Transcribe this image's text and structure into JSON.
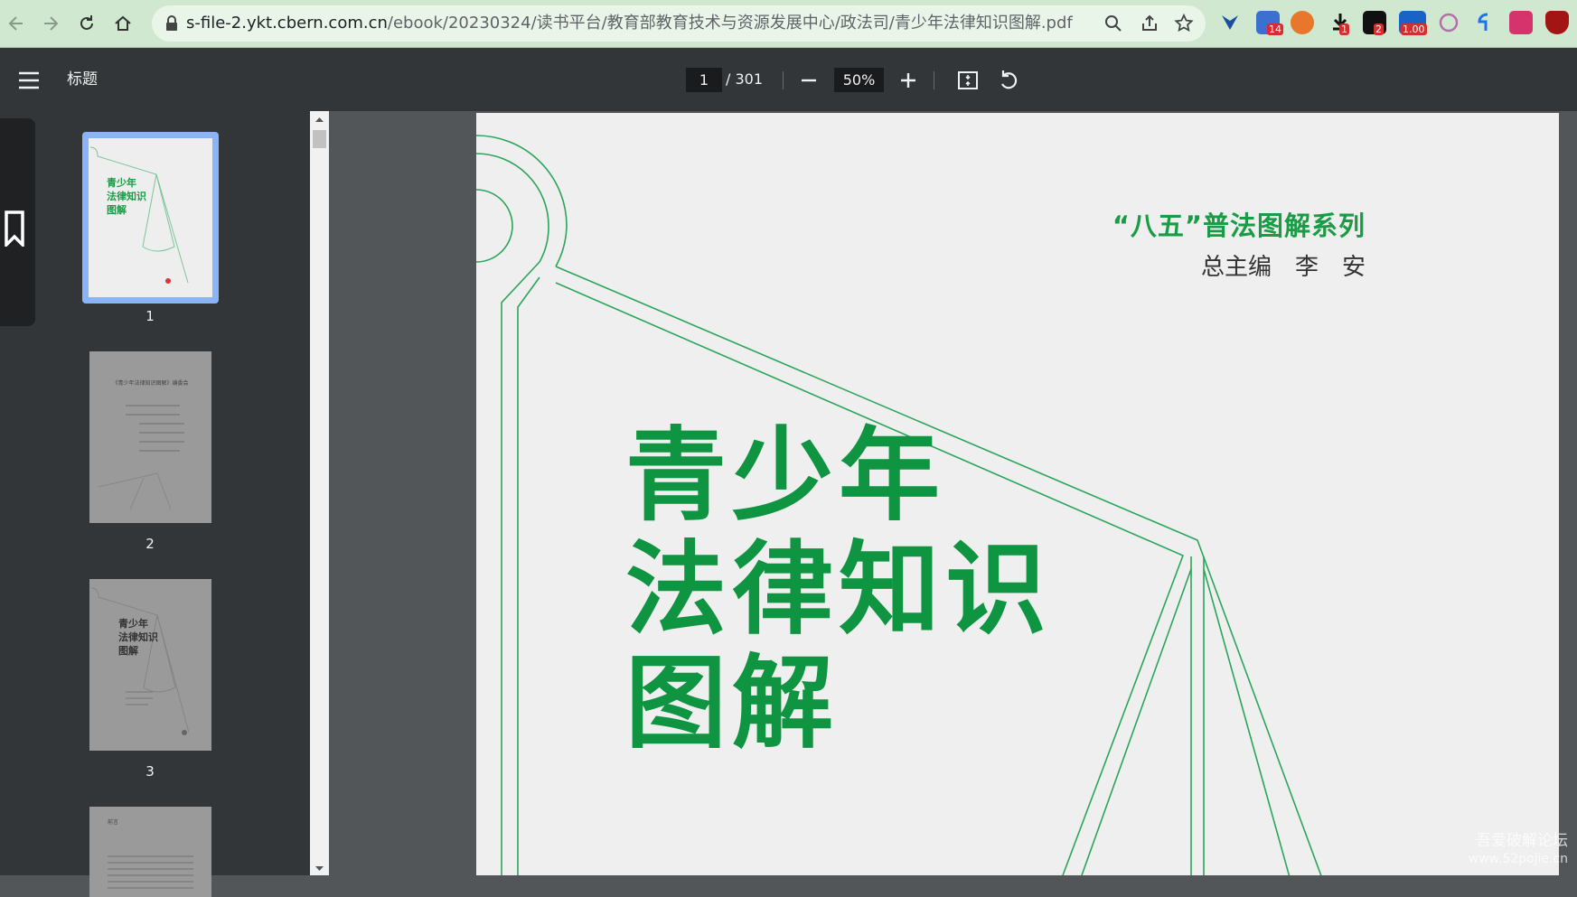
{
  "browser": {
    "url_host": "s-file-2.ykt.cbern.com.cn",
    "url_path": "/ebook/20230324/读书平台/教育部教育技术与资源发展中心/政法司/青少年法律知识图解.pdf",
    "extension_badges": [
      "14",
      "1",
      "2",
      "1.00"
    ]
  },
  "toolbar": {
    "title": "标题",
    "current_page": "1",
    "total_pages": "/ 301",
    "zoom": "50%"
  },
  "thumbnails": {
    "items": [
      {
        "number": "1",
        "title": "青少年\n法律知识\n图解"
      },
      {
        "number": "2",
        "title": "《青少年法律知识图解》编委会"
      },
      {
        "number": "3",
        "title": "青少年\n法律知识\n图解"
      },
      {
        "number": "4",
        "title": "前言"
      }
    ]
  },
  "page": {
    "series": "“八五”普法图解系列",
    "editor": "总主编　李　安",
    "title_lines": [
      "青少年",
      "法律知识",
      "图解"
    ]
  },
  "watermark": {
    "line1": "吾爱破解论坛",
    "line2": "www.52pojie.cn"
  },
  "colors": {
    "browser_bar": "#cfe8cf",
    "pdf_toolbar": "#323639",
    "title_green": "#0f9441",
    "series_green": "#1a9b45",
    "thumb_selected": "#8ab4f8"
  },
  "icons": [
    "back-icon",
    "forward-icon",
    "reload-icon",
    "home-icon",
    "lock-icon",
    "zoom-icon",
    "share-icon",
    "star-icon",
    "menu-icon",
    "minus-icon",
    "plus-icon",
    "fit-page-icon",
    "rotate-icon",
    "bookmark-icon"
  ]
}
